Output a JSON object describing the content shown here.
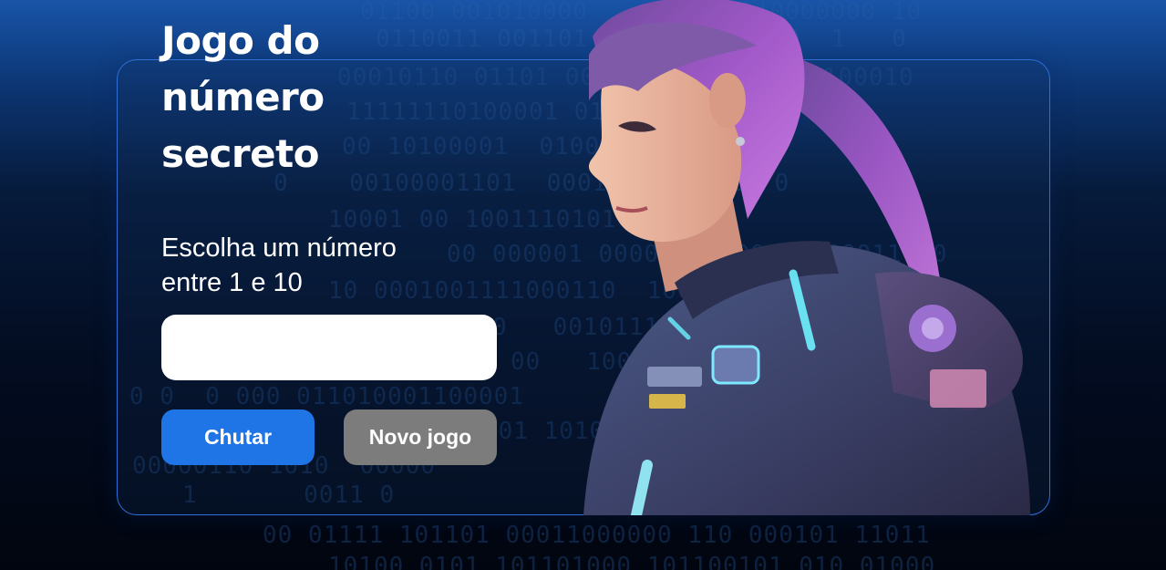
{
  "page": {
    "title": "Jogo do número secreto",
    "instruction": "Escolha um número entre 1 e 10"
  },
  "guess_input": {
    "value": "",
    "placeholder": ""
  },
  "buttons": {
    "guess_label": "Chutar",
    "new_game_label": "Novo jogo"
  },
  "background": {
    "binary_rows": [
      "01100 001010000        10010000000 10",
      "0110011 001101        11 1 0  1   0",
      "00010110 01101 000110001  101100100010",
      "11111110100001 01   00011 1 0",
      "00 10100001  0100  001011",
      "0    00100001101  0001  1  00 10 0",
      "10001 00 1001110101",
      "00 000001 000011010000  100011 00",
      "10 0001001111000110  1000",
      "0   0010111000101   00  1",
      "00   1000110  1",
      "0 0  0 000 011010001100001",
      "0 1101 101000011 010000  11 100",
      "00000110 1010  00000",
      "1       0011 0",
      "00 01111 101101 00011000000 110 000101 11011",
      "10100 0101 101101000 101100101 010 01000"
    ]
  },
  "colors": {
    "primary_button": "#1f75e6",
    "secondary_button": "#7c7c7c",
    "card_border": "#2f6fd6",
    "text": "#ffffff"
  },
  "icons": {
    "character": "sci-fi-girl-illustration"
  }
}
